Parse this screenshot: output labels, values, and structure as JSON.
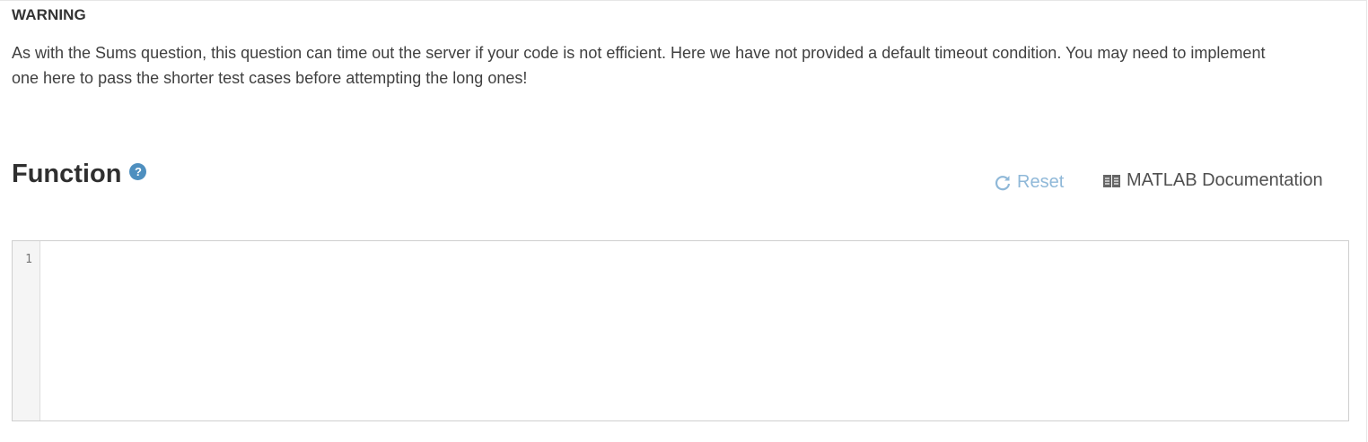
{
  "warning": {
    "title": "WARNING",
    "body": "As with the Sums question, this question can time out the server if your code is not efficient. Here we have not provided a default timeout condition. You may need to implement one here to pass the shorter test cases before attempting the long ones!"
  },
  "function_section": {
    "title": "Function",
    "help_icon": "question-circle-icon",
    "help_glyph": "?",
    "reset_label": "Reset",
    "reset_icon": "refresh-icon",
    "docs_label": "MATLAB Documentation",
    "docs_icon": "book-icon"
  },
  "editor": {
    "line_numbers": [
      "1"
    ],
    "code": ""
  },
  "colors": {
    "help_icon": "#4e8fbf",
    "reset": "#8fb8d8",
    "docs": "#505050"
  }
}
